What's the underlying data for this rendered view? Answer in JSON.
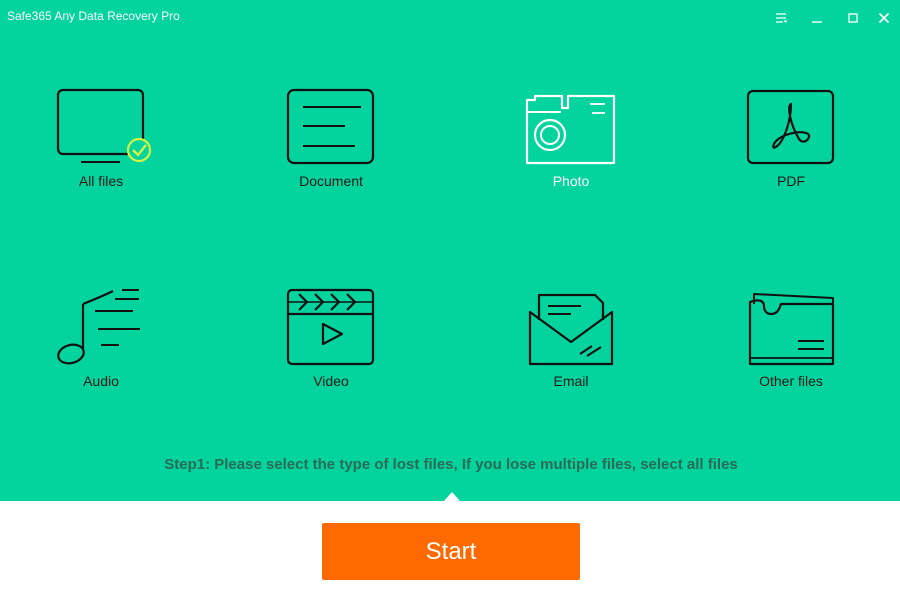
{
  "window": {
    "title": "Safe365 Any Data Recovery Pro",
    "controls": [
      "menu-icon",
      "minimize-icon",
      "maximize-icon",
      "close-icon"
    ]
  },
  "file_types": {
    "items": [
      {
        "label": "All files",
        "icon": "monitor-check-icon",
        "selected": true
      },
      {
        "label": "Document",
        "icon": "document-icon",
        "selected": false
      },
      {
        "label": "Photo",
        "icon": "camera-icon",
        "selected": false,
        "highlighted": true
      },
      {
        "label": "PDF",
        "icon": "pdf-icon",
        "selected": false
      },
      {
        "label": "Audio",
        "icon": "music-note-icon",
        "selected": false
      },
      {
        "label": "Video",
        "icon": "clapperboard-icon",
        "selected": false
      },
      {
        "label": "Email",
        "icon": "envelope-icon",
        "selected": false
      },
      {
        "label": "Other files",
        "icon": "folder-icon",
        "selected": false
      }
    ]
  },
  "instructions": {
    "step_text": "Step1: Please select the type of lost files, If you lose multiple files, select all files"
  },
  "actions": {
    "start_label": "Start"
  },
  "colors": {
    "background": "#03d49d",
    "accent": "#ff6a00",
    "check": "#d4f542",
    "step_text": "#2b6b56"
  }
}
